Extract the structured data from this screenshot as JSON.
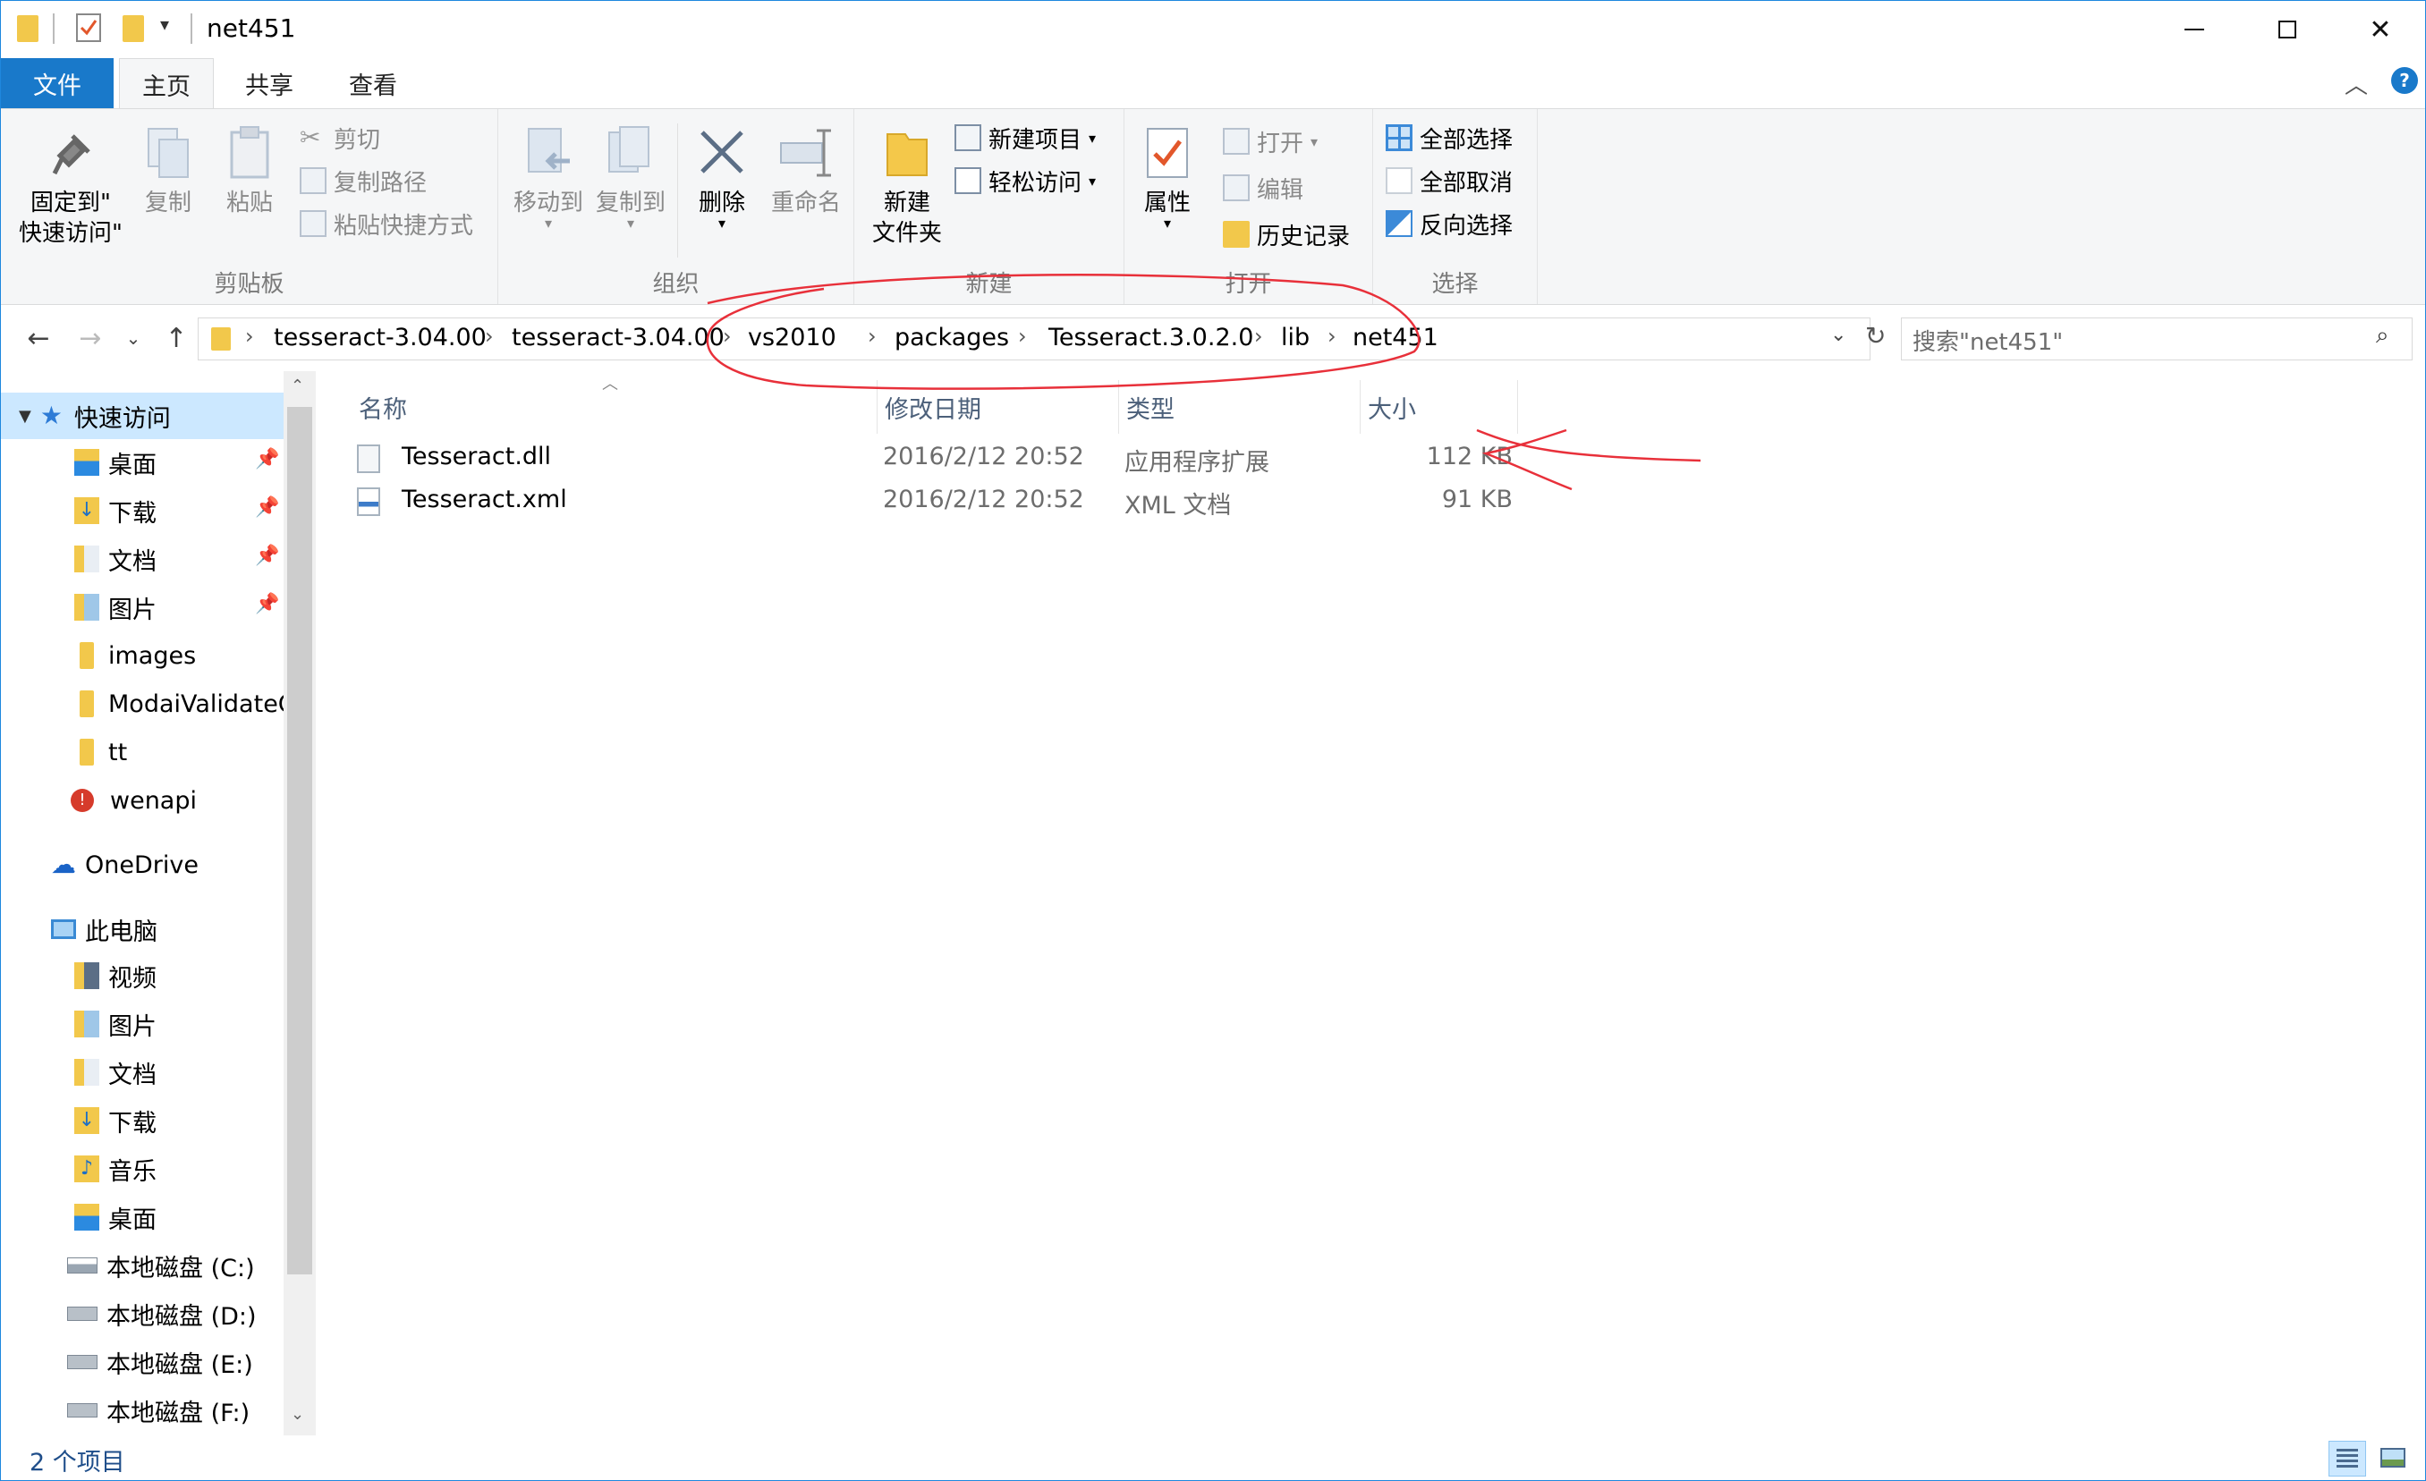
{
  "window": {
    "title": "net451"
  },
  "tabs": {
    "file": "文件",
    "home": "主页",
    "share": "共享",
    "view": "查看"
  },
  "ribbon": {
    "clipboard": {
      "label": "剪贴板",
      "pin_line1": "固定到\"",
      "pin_line2": "快速访问\"",
      "copy": "复制",
      "paste": "粘贴",
      "cut": "剪切",
      "copy_path": "复制路径",
      "paste_shortcut": "粘贴快捷方式"
    },
    "organize": {
      "label": "组织",
      "move_to": "移动到",
      "copy_to": "复制到",
      "delete": "删除",
      "rename": "重命名"
    },
    "new": {
      "label": "新建",
      "new_folder_line1": "新建",
      "new_folder_line2": "文件夹",
      "new_item": "新建项目",
      "easy_access": "轻松访问"
    },
    "open": {
      "label": "打开",
      "properties": "属性",
      "open": "打开",
      "edit": "编辑",
      "history": "历史记录"
    },
    "select": {
      "label": "选择",
      "select_all": "全部选择",
      "select_none": "全部取消",
      "invert": "反向选择"
    }
  },
  "address": {
    "crumbs": [
      "tesseract-3.04.00",
      "tesseract-3.04.00",
      "vs2010",
      "packages",
      "Tesseract.3.0.2.0",
      "lib",
      "net451"
    ],
    "search_placeholder": "搜索\"net451\""
  },
  "nav": {
    "quick_access": "快速访问",
    "quick_items": [
      "桌面",
      "下载",
      "文档",
      "图片",
      "images",
      "ModaiValidateC",
      "tt",
      "wenapi"
    ],
    "onedrive": "OneDrive",
    "this_pc": "此电脑",
    "pc_items": [
      "视频",
      "图片",
      "文档",
      "下载",
      "音乐",
      "桌面",
      "本地磁盘 (C:)",
      "本地磁盘 (D:)",
      "本地磁盘 (E:)",
      "本地磁盘 (F:)"
    ]
  },
  "columns": {
    "name": "名称",
    "date": "修改日期",
    "type": "类型",
    "size": "大小"
  },
  "files": [
    {
      "name": "Tesseract.dll",
      "date": "2016/2/12 20:52",
      "type": "应用程序扩展",
      "size": "112 KB"
    },
    {
      "name": "Tesseract.xml",
      "date": "2016/2/12 20:52",
      "type": "XML 文档",
      "size": "91 KB"
    }
  ],
  "status": {
    "count": "2 个项目"
  },
  "colors": {
    "accent": "#1979ca",
    "annotation": "#e8303a"
  }
}
